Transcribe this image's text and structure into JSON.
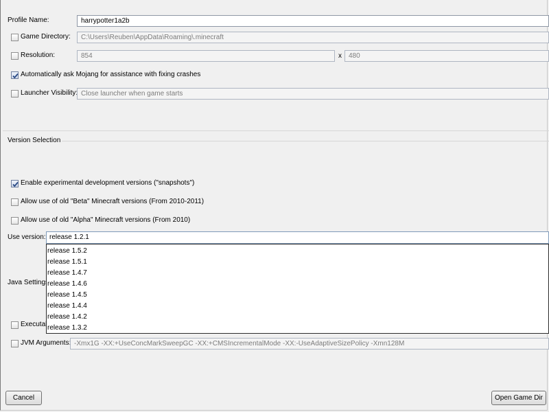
{
  "profile": {
    "name_label": "Profile Name:",
    "name_value": "harrypotter1a2b",
    "game_dir_label": "Game Directory:",
    "game_dir_value": "C:\\Users\\Reuben\\AppData\\Roaming\\.minecraft",
    "resolution_label": "Resolution:",
    "resolution_width": "854",
    "resolution_x": "x",
    "resolution_height": "480",
    "mojang_assist_label": "Automatically ask Mojang for assistance with fixing crashes",
    "launcher_visibility_label": "Launcher Visibility:",
    "launcher_visibility_value": "Close launcher when game starts"
  },
  "version": {
    "section_title": "Version Selection",
    "snapshots_label": "Enable experimental development versions (\"snapshots\")",
    "beta_label": "Allow use of old \"Beta\" Minecraft versions (From 2010-2011)",
    "alpha_label": "Allow use of old \"Alpha\" Minecraft versions (From 2010)",
    "use_version_label": "Use version:",
    "selected": "release 1.2.1",
    "options": [
      "release 1.5.2",
      "release 1.5.1",
      "release 1.4.7",
      "release 1.4.6",
      "release 1.4.5",
      "release 1.4.4",
      "release 1.4.2",
      "release 1.3.2"
    ]
  },
  "java": {
    "section_title": "Java Settings",
    "executable_label": "Executab",
    "jvm_label": "JVM Arguments:",
    "jvm_value": "-Xmx1G -XX:+UseConcMarkSweepGC -XX:+CMSIncrementalMode -XX:-UseAdaptiveSizePolicy -Xmn128M"
  },
  "checkboxes": {
    "game_dir": false,
    "resolution": false,
    "mojang_assist": true,
    "launcher_visibility": false,
    "snapshots": true,
    "beta": false,
    "alpha": false,
    "executable": false,
    "jvm": false
  },
  "buttons": {
    "cancel": "Cancel",
    "open_game_dir": "Open Game Dir"
  },
  "colors": {
    "check_mark": "#2a4a85",
    "dropdown_border": "#2b2b2b"
  }
}
